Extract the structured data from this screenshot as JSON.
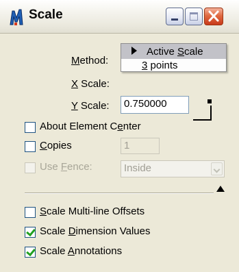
{
  "window": {
    "title": "Scale"
  },
  "method": {
    "label_prefix": "",
    "label_u": "M",
    "label_rest": "ethod:"
  },
  "x_scale": {
    "label_u": "X",
    "label_rest": " Scale:"
  },
  "y_scale": {
    "label_u": "Y",
    "label_rest": " Scale:",
    "value": "0.750000"
  },
  "menu": {
    "items": [
      {
        "pre": "Active ",
        "u": "S",
        "post": "cale",
        "selected": true
      },
      {
        "pre": "",
        "u": "3",
        "post": " points",
        "selected": false
      }
    ]
  },
  "about_center": {
    "pre": "About Element C",
    "u": "e",
    "post": "nter",
    "checked": false
  },
  "copies": {
    "u": "C",
    "post": "opies",
    "checked": false,
    "value": "1"
  },
  "use_fence": {
    "pre": "Use ",
    "u": "F",
    "post": "ence:",
    "checked": false,
    "select_value": "Inside"
  },
  "multiline": {
    "u": "S",
    "post": "cale Multi-line Offsets",
    "checked": false
  },
  "dimension": {
    "pre": "Scale ",
    "u": "D",
    "post": "imension Values",
    "checked": true
  },
  "annotations": {
    "pre": "Scale ",
    "u": "A",
    "post": "nnotations",
    "checked": true
  },
  "colors": {
    "title_bg": "#ece9d8",
    "close_red": "#e06b42",
    "check_green": "#21a121",
    "menu_highlight": "#c2c2c8"
  }
}
